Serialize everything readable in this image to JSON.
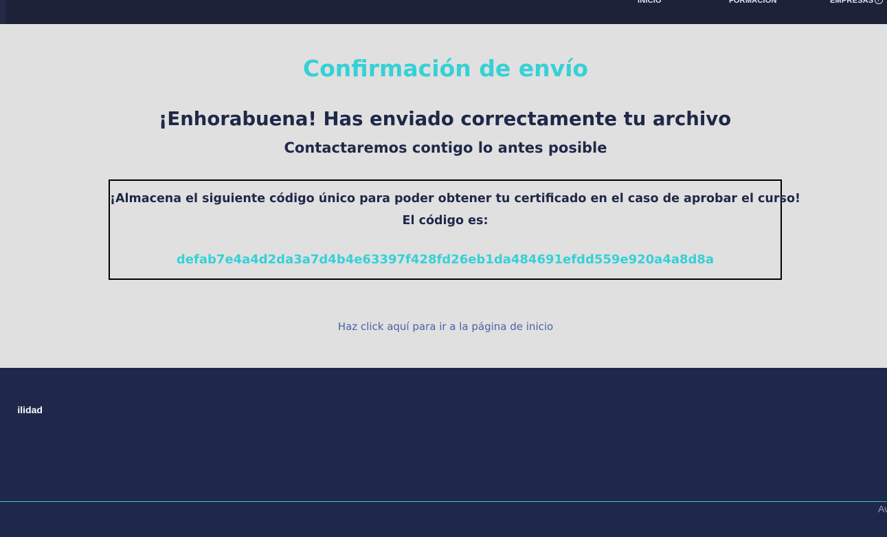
{
  "header": {
    "nav": {
      "inicio": "INICIO",
      "formacion": "FORMACIÓN",
      "empresas": "EMPRESAS"
    }
  },
  "main": {
    "title": "Confirmación de envío",
    "congrats": "¡Enhorabuena! Has enviado correctamente tu archivo",
    "contact": "Contactaremos contigo lo antes posible",
    "code_box": {
      "note": "¡Almacena el siguiente código único para poder obtener tu certificado en el caso de aprobar el curso!",
      "label": "El código es:",
      "value": "defab7e4a4d2da3a7d4b4e63397f428fd26eb1da484691efdd559e920a4a8d8a"
    },
    "home_link": "Haz click aquí para ir a la página de inicio"
  },
  "footer": {
    "link_partial": "ilidad",
    "legal_partial": "Av"
  },
  "colors": {
    "accent": "#35d1d6",
    "navy": "#1f284b",
    "header": "#1e2239",
    "content_bg": "#e0e0e0",
    "link": "#4a62a8"
  },
  "icons": {
    "nav_plus": "plus-circle-icon"
  }
}
